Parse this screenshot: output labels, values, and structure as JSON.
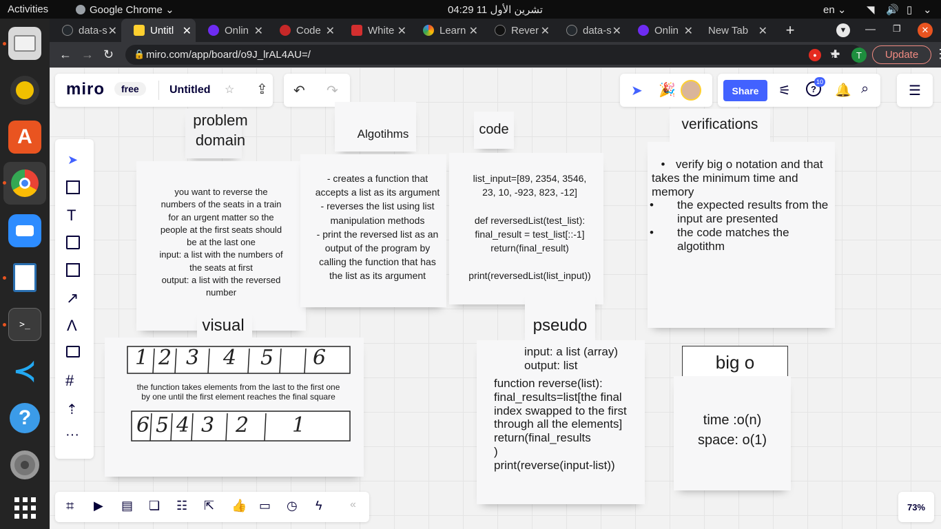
{
  "system": {
    "activities": "Activities",
    "app": "Google Chrome",
    "clock": "04:29 11 تشرين الأول",
    "lang": "en"
  },
  "tabs": [
    {
      "title": "data-s",
      "color": "#24292e"
    },
    {
      "title": "Untitl",
      "color": "#ffd02f"
    },
    {
      "title": "Onlin",
      "color": "#6e2cf2"
    },
    {
      "title": "Code",
      "color": "#c62828"
    },
    {
      "title": "White",
      "color": "#d32f2f"
    },
    {
      "title": "Learn",
      "color": "#4285f4"
    },
    {
      "title": "Rever",
      "color": "#111111"
    },
    {
      "title": "data-s",
      "color": "#24292e"
    },
    {
      "title": "Onlin",
      "color": "#6e2cf2"
    },
    {
      "title": "New Tab",
      "color": ""
    }
  ],
  "address": {
    "url": "miro.com/app/board/o9J_lrAL4AU=/",
    "update_label": "Update",
    "profile": "T"
  },
  "miro": {
    "logo": "miro",
    "plan": "free",
    "board_name": "Untitled",
    "share_label": "Share",
    "help_badge": "10",
    "zoom": "73%"
  },
  "notes": {
    "problem_title": "problem\ndomain",
    "problem_text": "you want to reverse the\nnumbers of the seats in a train\nfor an urgent matter so the\npeople at the first seats should\nbe at the last one\ninput: a list with the numbers of\nthe seats at first\noutput: a list with the reversed\nnumber",
    "algo_title": "Algotihms",
    "algo_text": "- creates a function that\naccepts a list as its argument\n- reverses the list using list\nmanipulation methods\n- print the reversed list as an\noutput of the program by\ncalling the function that has\nthe list as its argument",
    "code_title": "code",
    "code_text": "list_input=[89, 2354, 3546,\n23, 10, -923, 823, -12]\n\ndef reversedList(test_list):\n final_result = test_list[::-1]\n return(final_result)\n\nprint(reversedList(list_input))",
    "verif_title": "verifications",
    "verif_items": [
      "verify big o notation and that takes the minimum time and memory",
      "the expected results from the input are presented",
      "the code matches the algotithm"
    ],
    "visual_title": "visual",
    "visual_caption": "the function takes elements from the last to the first one\nby one until the first element reaches the final square",
    "visual_top": [
      "1",
      "2",
      "3",
      "4",
      "5",
      "6"
    ],
    "visual_bottom": [
      "6",
      "5",
      "4",
      "3",
      "2",
      "1"
    ],
    "pseudo_title": "pseudo",
    "pseudo_io": "input: a list (array)\noutput: list",
    "pseudo_body": "function reverse(list):\nfinal_results=list[the final\nindex swapped to the first\nthrough all the elements]\nreturn(final_results\n)\nprint(reverse(input-list))",
    "bigo_title": "big o",
    "bigo_text": "time :o(n)\nspace: o(1)"
  }
}
